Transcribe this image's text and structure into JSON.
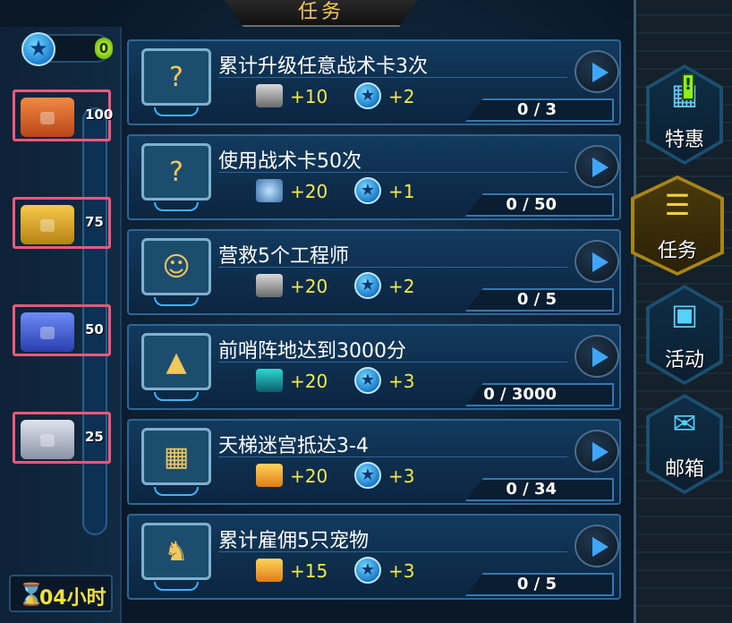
{
  "title": "任务",
  "stars": {
    "count": "0"
  },
  "chests": [
    {
      "mark": "100",
      "color": "orange"
    },
    {
      "mark": "75",
      "color": "gold"
    },
    {
      "mark": "50",
      "color": "blue"
    },
    {
      "mark": "25",
      "color": "silver"
    }
  ],
  "timer": {
    "hourglass": "⌛",
    "text": "04小时"
  },
  "missions": [
    {
      "title": "累计升级任意战术卡3次",
      "icon": "question-mark-icon",
      "reward1": {
        "icon": "device-icon",
        "text": "+10"
      },
      "reward2": {
        "icon": "star-icon",
        "text": "+2"
      },
      "progress": "0 / 3",
      "progress_fraction": 0
    },
    {
      "title": "使用战术卡50次",
      "icon": "question-mark-icon",
      "reward1": {
        "icon": "coin-icon",
        "text": "+20"
      },
      "reward2": {
        "icon": "star-icon",
        "text": "+1"
      },
      "progress": "0 / 50",
      "progress_fraction": 0
    },
    {
      "title": "营救5个工程师",
      "icon": "engineer-portrait-icon",
      "reward1": {
        "icon": "device-icon",
        "text": "+20"
      },
      "reward2": {
        "icon": "star-icon",
        "text": "+2"
      },
      "progress": "0 / 5",
      "progress_fraction": 0
    },
    {
      "title": "前哨阵地达到3000分",
      "icon": "outpost-icon",
      "reward1": {
        "icon": "weapon-crate-icon",
        "text": "+20"
      },
      "reward2": {
        "icon": "star-icon",
        "text": "+3"
      },
      "progress": "0 / 3000",
      "progress_fraction": 0
    },
    {
      "title": "天梯迷宫抵达3-4",
      "icon": "maze-icon",
      "reward1": {
        "icon": "gem-icon",
        "text": "+20"
      },
      "reward2": {
        "icon": "star-icon",
        "text": "+3"
      },
      "progress": "0 / 34",
      "progress_fraction": 0
    },
    {
      "title": "累计雇佣5只宠物",
      "icon": "pet-icon",
      "reward1": {
        "icon": "gem-icon",
        "text": "+15"
      },
      "reward2": {
        "icon": "star-icon",
        "text": "+3"
      },
      "progress": "0 / 5",
      "progress_fraction": 0
    }
  ],
  "nav": [
    {
      "label": "特惠",
      "icon": "calendar-icon",
      "active": false,
      "alert": "!"
    },
    {
      "label": "任务",
      "icon": "task-list-icon",
      "active": true
    },
    {
      "label": "活动",
      "icon": "gift-icon",
      "active": false
    },
    {
      "label": "邮箱",
      "icon": "mail-icon",
      "active": false
    }
  ],
  "colors": {
    "reward_text": "#f5e94c",
    "chest_orange": "#e2672b",
    "chest_gold": "#e3ac2c",
    "chest_blue": "#3b5fe0",
    "chest_silver": "#b2b9c8",
    "highlight_border": "#f0587a",
    "active_nav": "#a88516"
  }
}
